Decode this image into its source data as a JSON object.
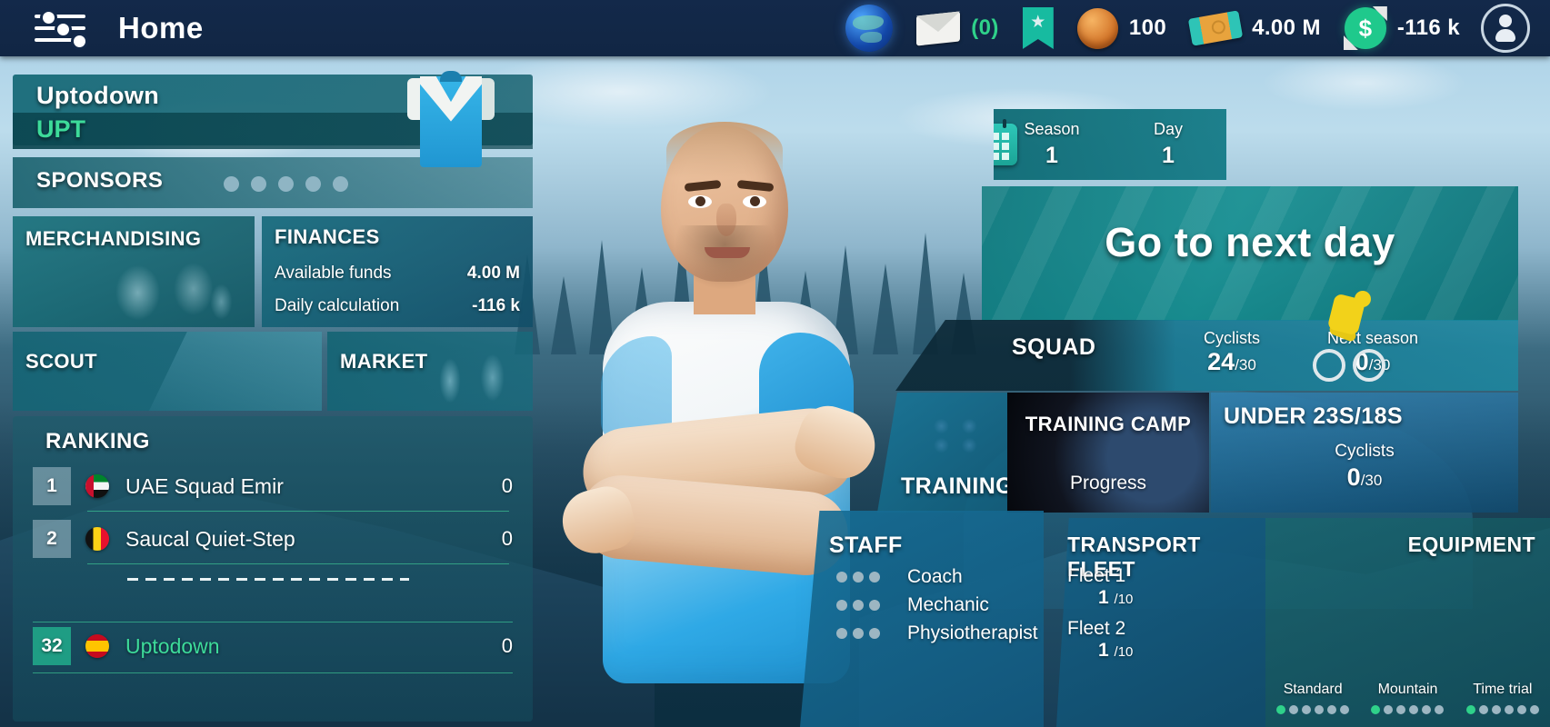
{
  "topbar": {
    "menu_icon": "sliders-icon",
    "title": "Home",
    "status": {
      "globe_icon": "globe-icon",
      "mail_icon": "envelope-icon",
      "mail_count": "(0)",
      "bookmark_icon": "bookmark-star-icon",
      "coin_icon": "coin-icon",
      "coin_value": "100",
      "cash_icon": "banknote-icon",
      "cash_value": "4.00 M",
      "balance_icon": "dollar-refresh-icon",
      "balance_value": "-116 k",
      "profile_icon": "profile-avatar-icon"
    }
  },
  "team": {
    "name": "Uptodown",
    "abbr": "UPT",
    "jersey_icon": "jersey-icon"
  },
  "sponsors": {
    "label": "SPONSORS",
    "slots": 5
  },
  "merchandising": {
    "label": "MERCHANDISING"
  },
  "finances": {
    "label": "FINANCES",
    "rows": [
      {
        "label": "Available funds",
        "value": "4.00 M"
      },
      {
        "label": "Daily calculation",
        "value": "-116 k"
      }
    ]
  },
  "scout": {
    "label": "SCOUT"
  },
  "market": {
    "label": "MARKET"
  },
  "ranking": {
    "label": "RANKING",
    "rows": [
      {
        "pos": "1",
        "flag": "ae",
        "team": "UAE Squad Emir",
        "points": "0",
        "me": false
      },
      {
        "pos": "2",
        "flag": "be",
        "team": "Saucal Quiet-Step",
        "points": "0",
        "me": false
      }
    ],
    "me_row": {
      "pos": "32",
      "flag": "es",
      "team": "Uptodown",
      "points": "0",
      "me": true
    }
  },
  "date": {
    "calendar_icon": "calendar-icon",
    "season_label": "Season",
    "season_value": "1",
    "day_label": "Day",
    "day_value": "1"
  },
  "next_day": {
    "label": "Go to next day",
    "rider_icon": "cyclist-icon"
  },
  "squad": {
    "label": "SQUAD",
    "cyclists_label": "Cyclists",
    "cyclists_value": "24",
    "cyclists_max": "/30",
    "next_season_label": "Next season",
    "next_season_value": "0",
    "next_season_max": "/30"
  },
  "training": {
    "label": "TRAINING"
  },
  "training_camp": {
    "label": "TRAINING CAMP",
    "status": "Progress"
  },
  "under23": {
    "label": "UNDER 23S/18S",
    "cyclists_label": "Cyclists",
    "cyclists_value": "0",
    "cyclists_max": "/30"
  },
  "staff": {
    "label": "STAFF",
    "roles": [
      {
        "name": "Coach",
        "pips": 3
      },
      {
        "name": "Mechanic",
        "pips": 3
      },
      {
        "name": "Physiotherapist",
        "pips": 3
      }
    ]
  },
  "fleet": {
    "label": "TRANSPORT FLEET",
    "items": [
      {
        "name": "Fleet 1",
        "value": "1",
        "max": "/10"
      },
      {
        "name": "Fleet 2",
        "value": "1",
        "max": "/10"
      }
    ]
  },
  "equipment": {
    "label": "EQUIPMENT",
    "categories": [
      {
        "name": "Standard",
        "total": 6,
        "filled": 1
      },
      {
        "name": "Mountain",
        "total": 6,
        "filled": 1
      },
      {
        "name": "Time trial",
        "total": 6,
        "filled": 1
      }
    ]
  },
  "colors": {
    "topbar": "#13294a",
    "accent_green": "#3ddb9a",
    "teal_panel": "#146876",
    "highlight": "#1f9d84"
  }
}
